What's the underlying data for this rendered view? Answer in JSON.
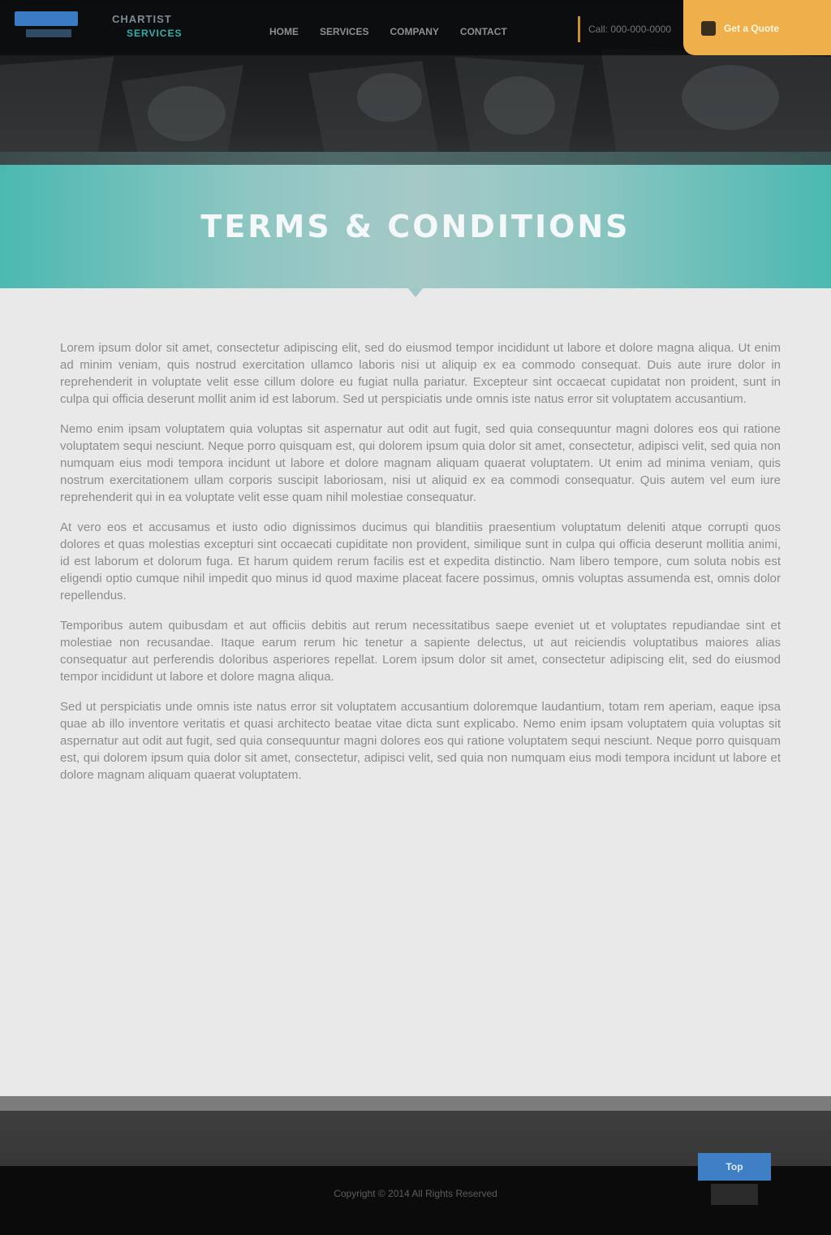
{
  "header": {
    "logo_title": "CHARTIST",
    "logo_subtitle": "SERVICES",
    "nav": [
      "Home",
      "Services",
      "Company",
      "Contact"
    ],
    "nav_sub": "",
    "phone": "Call: 000-000-0000",
    "cta_label": "Get a Quote"
  },
  "title_band": {
    "title": "Terms & Conditions"
  },
  "content": {
    "paragraphs": [
      "Lorem ipsum dolor sit amet, consectetur adipiscing elit, sed do eiusmod tempor incididunt ut labore et dolore magna aliqua. Ut enim ad minim veniam, quis nostrud exercitation ullamco laboris nisi ut aliquip ex ea commodo consequat. Duis aute irure dolor in reprehenderit in voluptate velit esse cillum dolore eu fugiat nulla pariatur. Excepteur sint occaecat cupidatat non proident, sunt in culpa qui officia deserunt mollit anim id est laborum. Sed ut perspiciatis unde omnis iste natus error sit voluptatem accusantium.",
      "Nemo enim ipsam voluptatem quia voluptas sit aspernatur aut odit aut fugit, sed quia consequuntur magni dolores eos qui ratione voluptatem sequi nesciunt. Neque porro quisquam est, qui dolorem ipsum quia dolor sit amet, consectetur, adipisci velit, sed quia non numquam eius modi tempora incidunt ut labore et dolore magnam aliquam quaerat voluptatem. Ut enim ad minima veniam, quis nostrum exercitationem ullam corporis suscipit laboriosam, nisi ut aliquid ex ea commodi consequatur. Quis autem vel eum iure reprehenderit qui in ea voluptate velit esse quam nihil molestiae consequatur.",
      "At vero eos et accusamus et iusto odio dignissimos ducimus qui blanditiis praesentium voluptatum deleniti atque corrupti quos dolores et quas molestias excepturi sint occaecati cupiditate non provident, similique sunt in culpa qui officia deserunt mollitia animi, id est laborum et dolorum fuga. Et harum quidem rerum facilis est et expedita distinctio. Nam libero tempore, cum soluta nobis est eligendi optio cumque nihil impedit quo minus id quod maxime placeat facere possimus, omnis voluptas assumenda est, omnis dolor repellendus.",
      "Temporibus autem quibusdam et aut officiis debitis aut rerum necessitatibus saepe eveniet ut et voluptates repudiandae sint et molestiae non recusandae. Itaque earum rerum hic tenetur a sapiente delectus, ut aut reiciendis voluptatibus maiores alias consequatur aut perferendis doloribus asperiores repellat. Lorem ipsum dolor sit amet, consectetur adipiscing elit, sed do eiusmod tempor incididunt ut labore et dolore magna aliqua.",
      "Sed ut perspiciatis unde omnis iste natus error sit voluptatem accusantium doloremque laudantium, totam rem aperiam, eaque ipsa quae ab illo inventore veritatis et quasi architecto beatae vitae dicta sunt explicabo. Nemo enim ipsam voluptatem quia voluptas sit aspernatur aut odit aut fugit, sed quia consequuntur magni dolores eos qui ratione voluptatem sequi nesciunt. Neque porro quisquam est, qui dolorem ipsum quia dolor sit amet, consectetur, adipisci velit, sed quia non numquam eius modi tempora incidunt ut labore et dolore magnam aliquam quaerat voluptatem."
    ]
  },
  "footer": {
    "copyright": "Copyright © 2014 All Rights Reserved",
    "back_to_top": "Top"
  },
  "colors": {
    "accent_teal": "#4bb9b1",
    "accent_orange": "#efb04c",
    "accent_blue": "#3f7fc6"
  }
}
